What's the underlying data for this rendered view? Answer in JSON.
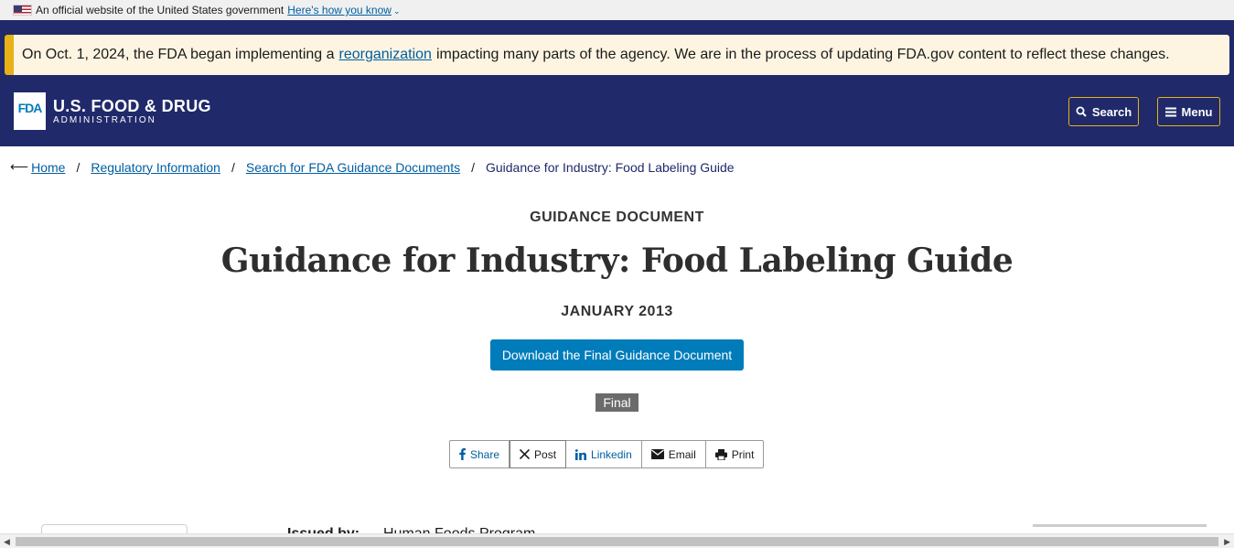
{
  "gov_banner": {
    "text": "An official website of the United States government",
    "link": "Here's how you know",
    "chevron": "⌄"
  },
  "alert": {
    "before": "On Oct. 1, 2024, the FDA began implementing a",
    "link": "reorganization",
    "after": "impacting many parts of the agency. We are in the process of updating FDA.gov content to reflect these changes."
  },
  "header": {
    "logo_mark": "FDA",
    "logo_main": "U.S. FOOD & DRUG",
    "logo_sub": "ADMINISTRATION",
    "search_label": "Search",
    "menu_label": "Menu"
  },
  "breadcrumb": {
    "back_arrow": "⟵",
    "items": [
      "Home",
      "Regulatory Information",
      "Search for FDA Guidance Documents"
    ],
    "separator": "/",
    "current": "Guidance for Industry: Food Labeling Guide"
  },
  "document": {
    "type": "GUIDANCE DOCUMENT",
    "title": "Guidance for Industry: Food Labeling Guide",
    "date": "JANUARY 2013",
    "download_label": "Download the Final Guidance Document",
    "status": "Final"
  },
  "share": {
    "facebook": "Share",
    "x": "Post",
    "linkedin": "Linkedin",
    "email": "Email",
    "print": "Print"
  },
  "details": {
    "issued_by_label": "Issued by:",
    "issued_by_value": "Human Foods Program"
  },
  "colors": {
    "navy": "#20296a",
    "gold": "#e8b216",
    "link_blue": "#005ea2",
    "button_blue": "#007cba"
  }
}
